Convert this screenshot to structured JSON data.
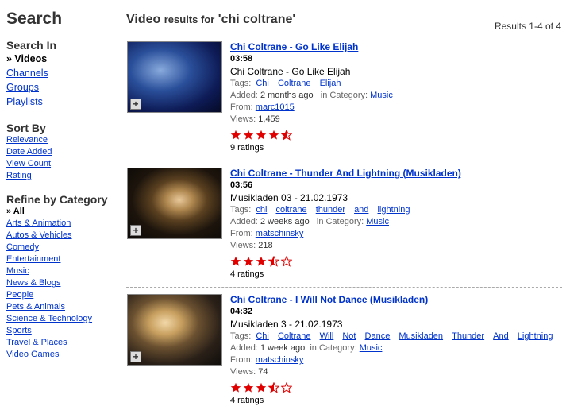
{
  "header": {
    "search_title": "Search",
    "results_prefix": "Video",
    "results_for": "results for",
    "query": "'chi coltrane'",
    "results_count": "Results 1-4 of 4"
  },
  "sidebar": {
    "search_in": {
      "heading": "Search In",
      "current": "» Videos",
      "links": [
        "Channels",
        "Groups",
        "Playlists"
      ]
    },
    "sort_by": {
      "heading": "Sort By",
      "links": [
        "Relevance",
        "Date Added",
        "View Count",
        "Rating"
      ]
    },
    "refine": {
      "heading": "Refine by Category",
      "current": "» All",
      "links": [
        "Arts & Animation",
        "Autos & Vehicles",
        "Comedy",
        "Entertainment",
        "Music",
        "News & Blogs",
        "People",
        "Pets & Animals",
        "Science & Technology",
        "Sports",
        "Travel & Places",
        "Video Games"
      ]
    }
  },
  "labels": {
    "tags": "Tags:",
    "added": "Added:",
    "in_category": "in Category:",
    "from": "From:",
    "views": "Views:"
  },
  "results": [
    {
      "title": "Chi Coltrane - Go Like Elijah",
      "duration": "03:58",
      "description": "Chi Coltrane - Go Like Elijah",
      "tags": [
        "Chi",
        "Coltrane",
        "Elijah"
      ],
      "added": "2 months ago",
      "category": "Music",
      "from": "marc1015",
      "views": "1,459",
      "rating": 4.5,
      "ratings_text": "9 ratings"
    },
    {
      "title": "Chi Coltrane - Thunder And Lightning (Musikladen)",
      "duration": "03:56",
      "description": "Musikladen 03 - 21.02.1973",
      "tags": [
        "chi",
        "coltrane",
        "thunder",
        "and",
        "lightning"
      ],
      "added": "2 weeks ago",
      "category": "Music",
      "from": "matschinsky",
      "views": "218",
      "rating": 3.5,
      "ratings_text": "4 ratings"
    },
    {
      "title": "Chi Coltrane - I Will Not Dance (Musikladen)",
      "duration": "04:32",
      "description": "Musikladen 3 - 21.02.1973",
      "tags": [
        "Chi",
        "Coltrane",
        "Will",
        "Not",
        "Dance",
        "Musikladen",
        "Thunder",
        "And",
        "Lightning"
      ],
      "added": "1 week ago",
      "category": "Music",
      "from": "matschinsky",
      "views": "74",
      "rating": 3.5,
      "ratings_text": "4 ratings"
    }
  ],
  "colors": {
    "link": "#0033cc",
    "star": "#e00000"
  }
}
